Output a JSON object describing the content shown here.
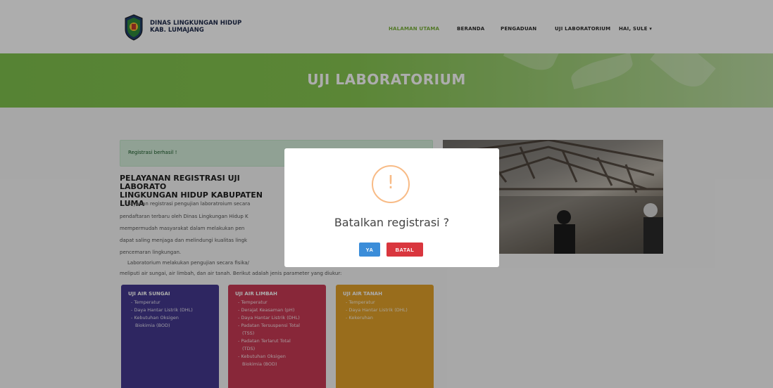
{
  "navbar": {
    "brand_line1": "DINAS LINGKUNGAN HIDUP",
    "brand_line2": "KAB. LUMAJANG",
    "items": [
      "HALAMAN UTAMA",
      "BERANDA",
      "PENGADUAN",
      "UJI LABORATORIUM",
      "HAI, SULE ▾"
    ],
    "active_color": "#79b23a"
  },
  "banner": {
    "title": "UJI LABORATORIUM"
  },
  "alert": {
    "text": "Registrasi berhasil !"
  },
  "content": {
    "heading_line1": "PELAYANAN REGISTRASI UJI LABORATO",
    "heading_line2": "LINGKUNGAN HIDUP KABUPATEN LUMA",
    "paragraph_lines": [
      "Layanan registrasi pengujian laboratroium secara",
      "pendaftaran terbaru oleh Dinas Lingkungan Hidup K",
      "mempermudah masyarakat dalam melakukan pen",
      "dapat saling menjaga dan melindungi kualitas lingk",
      "pencemaran lingkungan.",
      "Laboratorium melakukan pengujian secara fisika/",
      "meliputi air sungai, air limbah, dan air tanah. Berikut adalah jenis parameter yang diukur:"
    ]
  },
  "cards": [
    {
      "title": "UJI AIR SUNGAI",
      "color": "#45388f",
      "items": [
        "- Temperatur",
        "- Daya Hantar Listrik (DHL)",
        "- Kebutuhan Oksigen",
        "  Biokimia (BOD)"
      ]
    },
    {
      "title": "UJI AIR LIMBAH",
      "color": "#c93a55",
      "items": [
        "- Temperatur",
        "- Derajat Keasaman (pH)",
        "- Daya Hantar Listrik (DHL)",
        "- Padatan Tersuspensi Total",
        "  (TSS)",
        "- Padatan Terlarut Total",
        "  (TDS)",
        "- Kebutuhan Oksigen",
        "  Biokimia (BOD)"
      ]
    },
    {
      "title": "UJI AIR TANAH",
      "color": "#e2a12a",
      "items": [
        "- Temperatur",
        "- Daya Hantar Listrik (DHL)",
        "- Kekeruhan"
      ]
    }
  ],
  "modal": {
    "icon": "warning-icon",
    "icon_glyph": "!",
    "title": "Batalkan registrasi ?",
    "confirm_label": "YA",
    "cancel_label": "BATAL"
  }
}
